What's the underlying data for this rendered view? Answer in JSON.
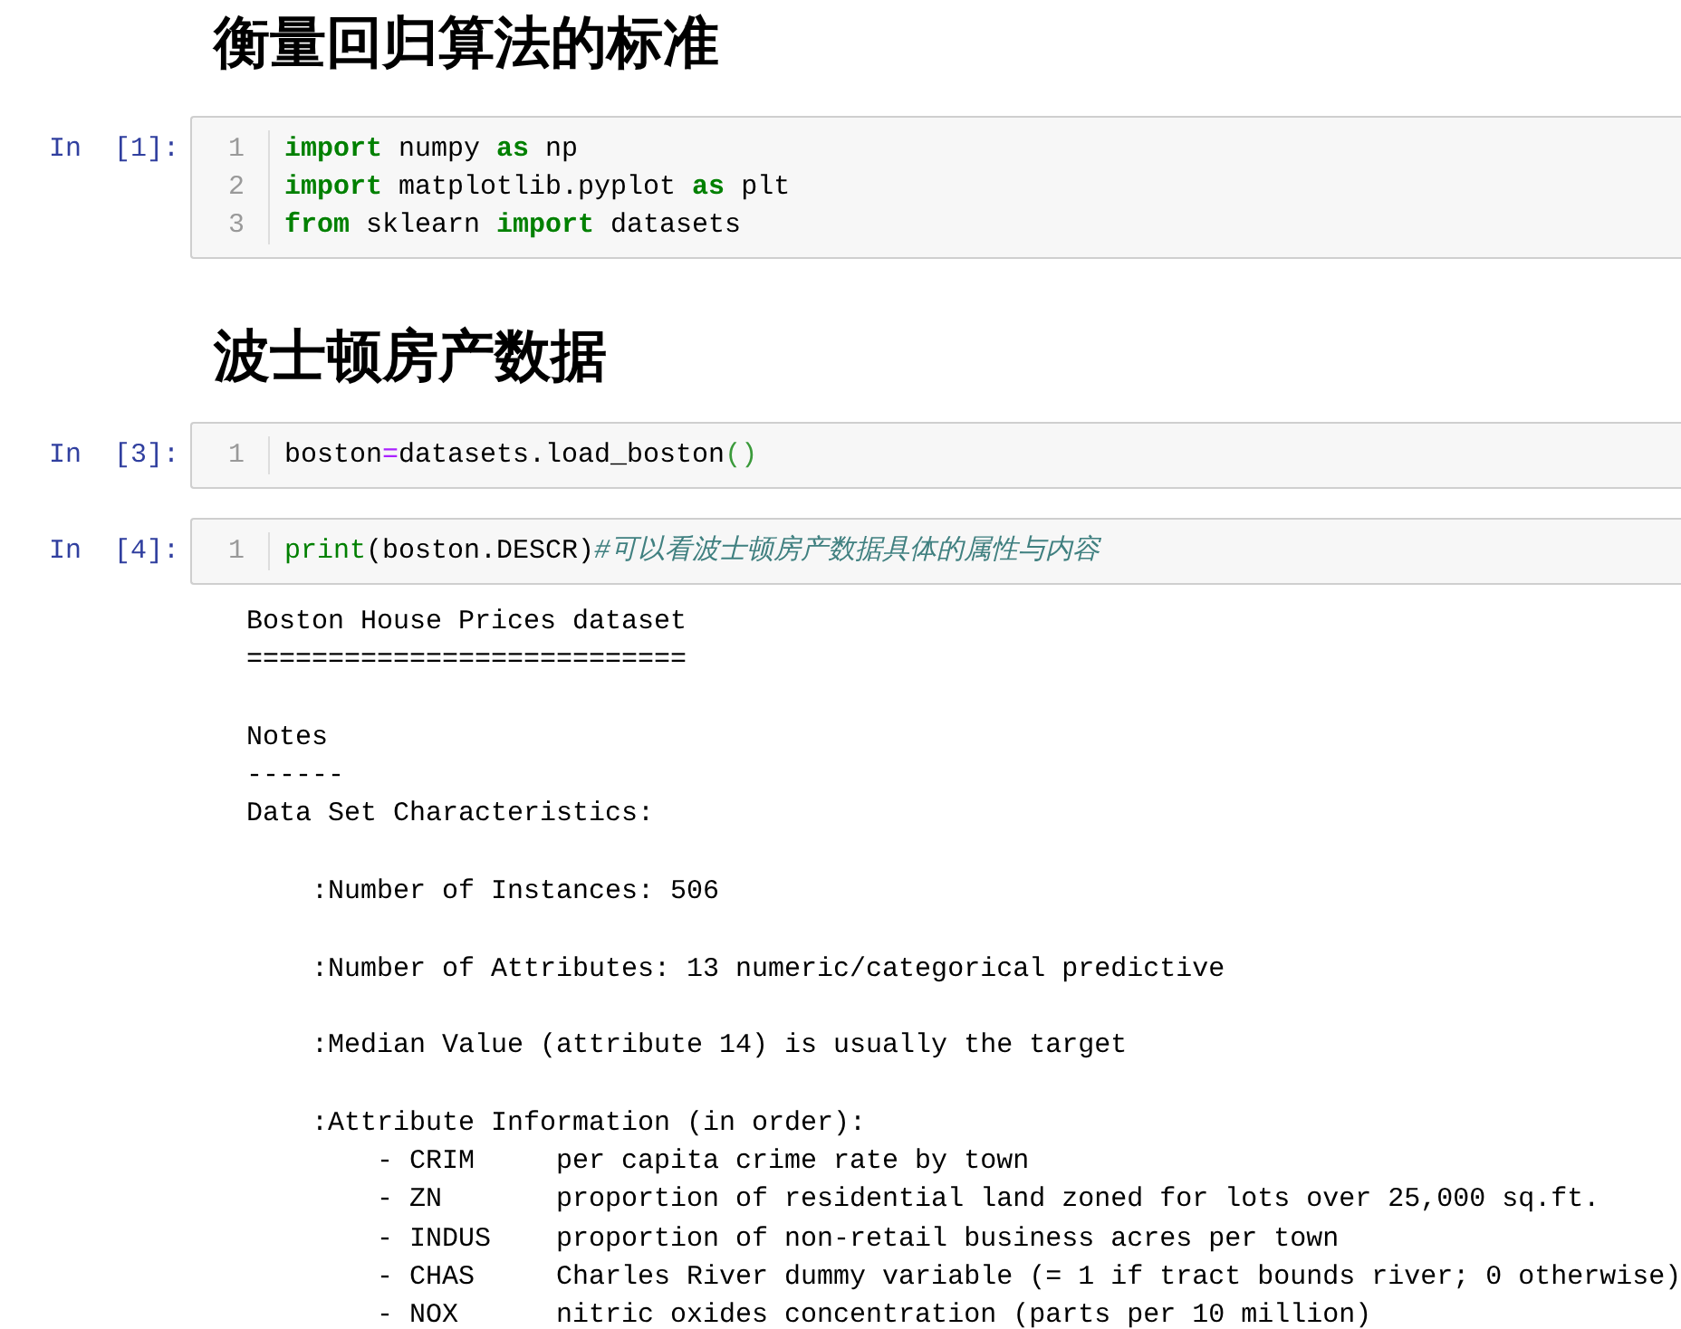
{
  "cells": [
    {
      "kind": "heading",
      "text": "衡量回归算法的标准"
    },
    {
      "kind": "code",
      "prompt": "In  [1]:",
      "lines": [
        {
          "number": "1",
          "tokens": [
            {
              "kind": "keyword",
              "text": "import"
            },
            {
              "kind": "plain",
              "text": " numpy "
            },
            {
              "kind": "keyword",
              "text": "as"
            },
            {
              "kind": "plain",
              "text": " np"
            }
          ]
        },
        {
          "number": "2",
          "tokens": [
            {
              "kind": "keyword",
              "text": "import"
            },
            {
              "kind": "plain",
              "text": " matplotlib.pyplot "
            },
            {
              "kind": "keyword",
              "text": "as"
            },
            {
              "kind": "plain",
              "text": " plt"
            }
          ]
        },
        {
          "number": "3",
          "tokens": [
            {
              "kind": "keyword",
              "text": "from"
            },
            {
              "kind": "plain",
              "text": " sklearn "
            },
            {
              "kind": "keyword",
              "text": "import"
            },
            {
              "kind": "plain",
              "text": " datasets"
            }
          ]
        }
      ]
    },
    {
      "kind": "heading",
      "text": "波士顿房产数据"
    },
    {
      "kind": "code",
      "prompt": "In  [3]:",
      "lines": [
        {
          "number": "1",
          "tokens": [
            {
              "kind": "plain",
              "text": "boston"
            },
            {
              "kind": "operator",
              "text": "="
            },
            {
              "kind": "plain",
              "text": "datasets.load_boston"
            },
            {
              "kind": "bracket",
              "text": "()"
            }
          ]
        }
      ]
    },
    {
      "kind": "code",
      "prompt": "In  [4]:",
      "lines": [
        {
          "number": "1",
          "tokens": [
            {
              "kind": "builtin",
              "text": "print"
            },
            {
              "kind": "plain",
              "text": "(boston.DESCR)"
            },
            {
              "kind": "comment",
              "text": "#可以看波士顿房产数据具体的属性与内容"
            }
          ]
        }
      ],
      "output_blocks": [
        [
          "Boston House Prices dataset",
          "==========================="
        ],
        [
          "Notes",
          "------",
          "Data Set Characteristics:"
        ],
        [
          "    :Number of Instances: 506"
        ],
        [
          "    :Number of Attributes: 13 numeric/categorical predictive"
        ],
        [
          "    :Median Value (attribute 14) is usually the target"
        ],
        [
          "    :Attribute Information (in order):",
          "        - CRIM     per capita crime rate by town",
          "        - ZN       proportion of residential land zoned for lots over 25,000 sq.ft.",
          "        - INDUS    proportion of non-retail business acres per town",
          "        - CHAS     Charles River dummy variable (= 1 if tract bounds river; 0 otherwise)",
          "        - NOX      nitric oxides concentration (parts per 10 million)"
        ]
      ]
    }
  ]
}
